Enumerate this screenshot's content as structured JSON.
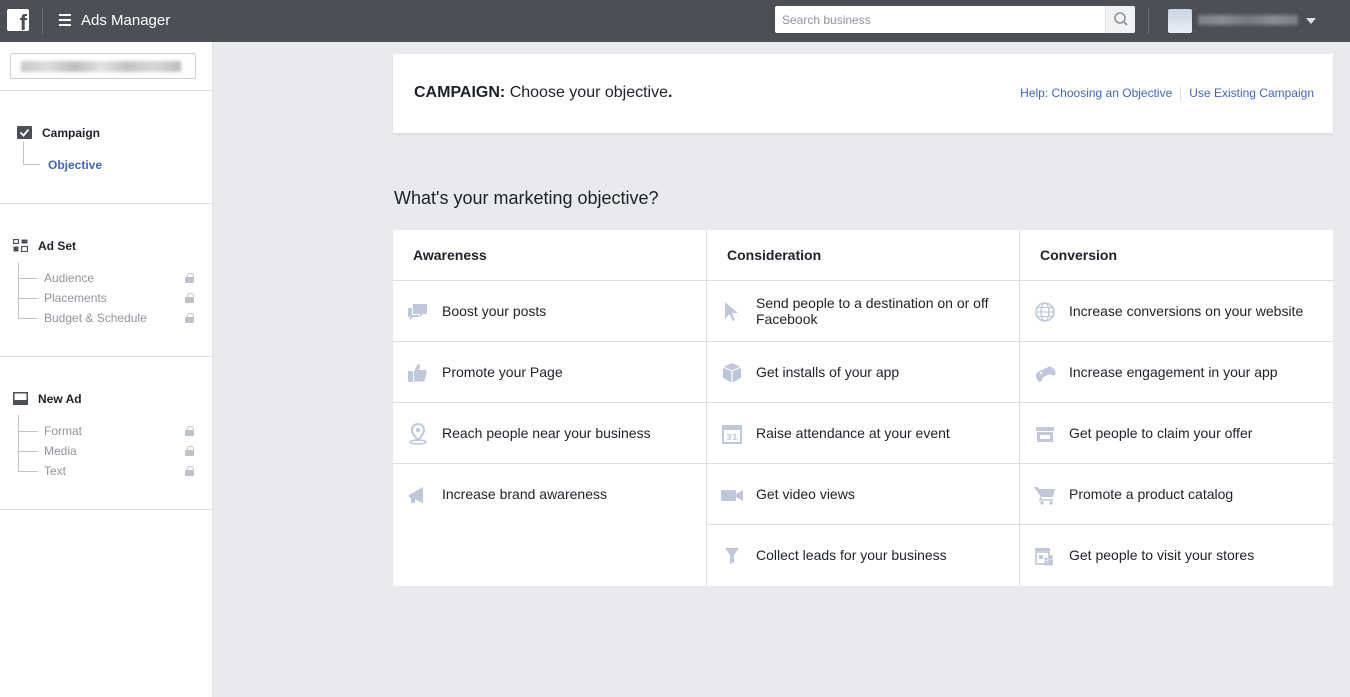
{
  "topbar": {
    "logo_letter": "f",
    "app_title": "Ads Manager",
    "search_placeholder": "Search business"
  },
  "sidebar": {
    "campaign": {
      "label": "Campaign",
      "items": [
        {
          "label": "Objective",
          "active": true
        }
      ]
    },
    "adset": {
      "label": "Ad Set",
      "items": [
        {
          "label": "Audience"
        },
        {
          "label": "Placements"
        },
        {
          "label": "Budget & Schedule"
        }
      ]
    },
    "newad": {
      "label": "New Ad",
      "items": [
        {
          "label": "Format"
        },
        {
          "label": "Media"
        },
        {
          "label": "Text"
        }
      ]
    }
  },
  "campaign_card": {
    "title_bold": "CAMPAIGN:",
    "title_rest": " Choose your objective",
    "title_end": ".",
    "help_link": "Help: Choosing an Objective",
    "existing_link": "Use Existing Campaign"
  },
  "question": "What's your marketing objective?",
  "columns": [
    {
      "heading": "Awareness",
      "objectives": [
        {
          "label": "Boost your posts",
          "icon": "speech-bubbles-icon"
        },
        {
          "label": "Promote your Page",
          "icon": "thumbs-up-icon"
        },
        {
          "label": "Reach people near your business",
          "icon": "map-pin-icon"
        },
        {
          "label": "Increase brand awareness",
          "icon": "megaphone-icon"
        }
      ]
    },
    {
      "heading": "Consideration",
      "objectives": [
        {
          "label": "Send people to a destination on or off Facebook",
          "icon": "cursor-icon"
        },
        {
          "label": "Get installs of your app",
          "icon": "box-icon"
        },
        {
          "label": "Raise attendance at your event",
          "icon": "calendar-icon"
        },
        {
          "label": "Get video views",
          "icon": "video-camera-icon"
        },
        {
          "label": "Collect leads for your business",
          "icon": "funnel-icon"
        }
      ]
    },
    {
      "heading": "Conversion",
      "objectives": [
        {
          "label": "Increase conversions on your website",
          "icon": "globe-icon"
        },
        {
          "label": "Increase engagement in your app",
          "icon": "gamepad-icon"
        },
        {
          "label": "Get people to claim your offer",
          "icon": "storefront-icon"
        },
        {
          "label": "Promote a product catalog",
          "icon": "shopping-cart-icon"
        },
        {
          "label": "Get people to visit your stores",
          "icon": "store-people-icon"
        }
      ]
    }
  ],
  "colors": {
    "topbar": "#4b4f56",
    "link": "#4267b2",
    "icon": "#bec8da"
  }
}
